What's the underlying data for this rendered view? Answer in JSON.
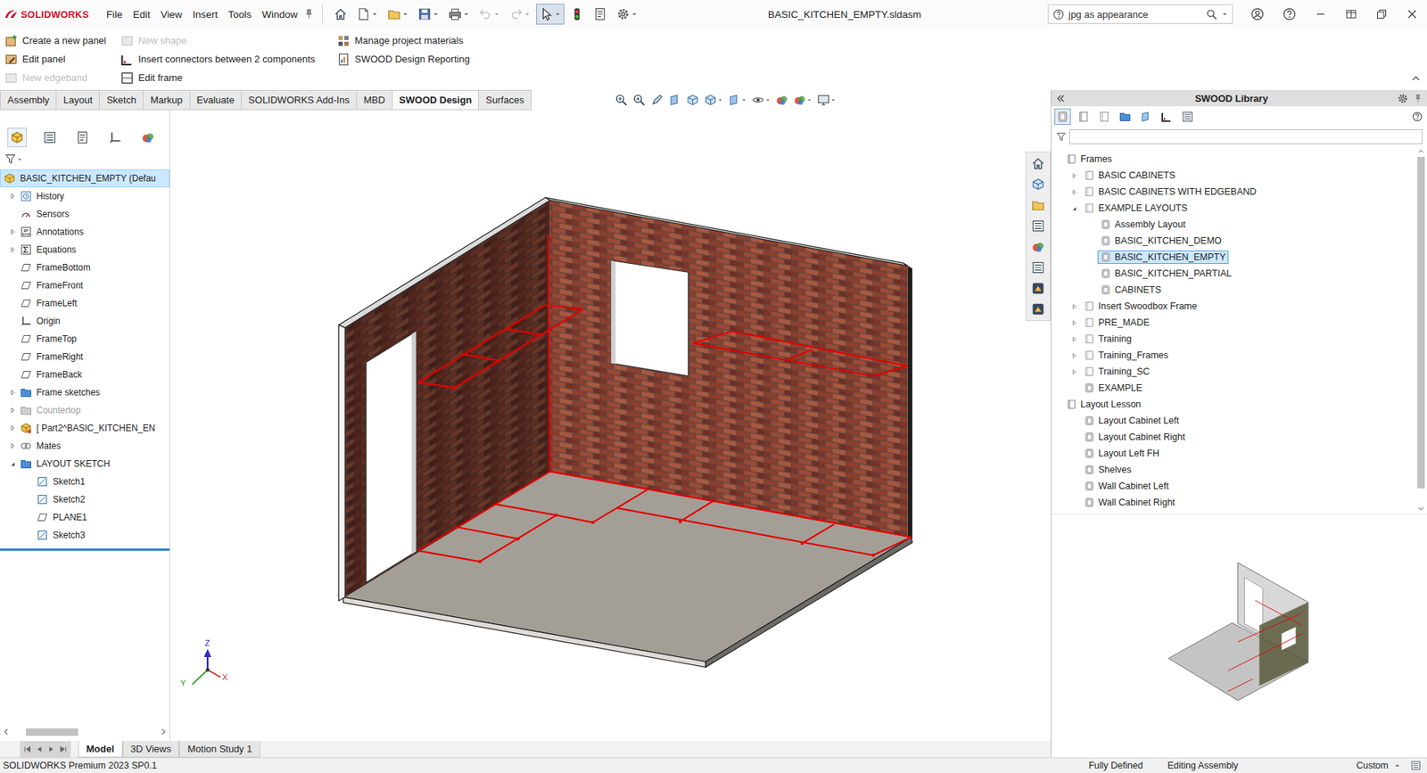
{
  "window": {
    "logo": "SOLIDWORKS",
    "title": "BASIC_KITCHEN_EMPTY.sldasm"
  },
  "menu": [
    "File",
    "Edit",
    "View",
    "Insert",
    "Tools",
    "Window"
  ],
  "quick_access": [
    {
      "disabled": false,
      "selected": false
    },
    {
      "disabled": false,
      "selected": false
    },
    {
      "disabled": false,
      "selected": false
    },
    {
      "disabled": false,
      "selected": false
    },
    {
      "disabled": false,
      "selected": false
    },
    {
      "disabled": true,
      "selected": false
    },
    {
      "disabled": true,
      "selected": false
    },
    {
      "disabled": false,
      "selected": true
    },
    {
      "disabled": false,
      "selected": false
    },
    {
      "disabled": false,
      "selected": false
    },
    {
      "disabled": false,
      "selected": false
    }
  ],
  "search": {
    "value": "jpg as appearance"
  },
  "commands": [
    {
      "label": "Create a new panel",
      "disabled": false
    },
    {
      "label": "Edit panel",
      "disabled": false
    },
    {
      "label": "New edgeband",
      "disabled": true
    },
    {
      "label": "New shape",
      "disabled": true
    },
    {
      "label": "Insert connectors between 2 components",
      "disabled": false
    },
    {
      "label": "Edit frame",
      "disabled": false
    },
    {
      "label": "Manage project materials",
      "disabled": false
    },
    {
      "label": "SWOOD Design Reporting",
      "disabled": false
    }
  ],
  "tabs": [
    {
      "label": "Assembly",
      "selected": false
    },
    {
      "label": "Layout",
      "selected": false
    },
    {
      "label": "Sketch",
      "selected": false
    },
    {
      "label": "Markup",
      "selected": false
    },
    {
      "label": "Evaluate",
      "selected": false
    },
    {
      "label": "SOLIDWORKS Add-Ins",
      "selected": false
    },
    {
      "label": "MBD",
      "selected": false
    },
    {
      "label": "SWOOD Design",
      "selected": true
    },
    {
      "label": "Surfaces",
      "selected": false
    }
  ],
  "feature_tree": {
    "panel_tabs": [
      {
        "selected": true
      },
      {
        "selected": false
      },
      {
        "selected": false
      },
      {
        "selected": false
      },
      {
        "selected": false
      }
    ],
    "items": [
      {
        "label": "BASIC_KITCHEN_EMPTY (Defau",
        "level": 0,
        "kind": "assembly",
        "expandable": false,
        "expanded": false,
        "selected": true,
        "disabled": false
      },
      {
        "label": "History",
        "level": 1,
        "kind": "history",
        "expandable": true,
        "expanded": false,
        "selected": false,
        "disabled": false
      },
      {
        "label": "Sensors",
        "level": 1,
        "kind": "sensor",
        "expandable": false,
        "expanded": false,
        "selected": false,
        "disabled": false
      },
      {
        "label": "Annotations",
        "level": 1,
        "kind": "annotation",
        "expandable": true,
        "expanded": false,
        "selected": false,
        "disabled": false
      },
      {
        "label": "Equations",
        "level": 1,
        "kind": "equation",
        "expandable": true,
        "expanded": false,
        "selected": false,
        "disabled": false
      },
      {
        "label": "FrameBottom",
        "level": 1,
        "kind": "plane",
        "expandable": false,
        "expanded": false,
        "selected": false,
        "disabled": false
      },
      {
        "label": "FrameFront",
        "level": 1,
        "kind": "plane",
        "expandable": false,
        "expanded": false,
        "selected": false,
        "disabled": false
      },
      {
        "label": "FrameLeft",
        "level": 1,
        "kind": "plane",
        "expandable": false,
        "expanded": false,
        "selected": false,
        "disabled": false
      },
      {
        "label": "Origin",
        "level": 1,
        "kind": "origin",
        "expandable": false,
        "expanded": false,
        "selected": false,
        "disabled": false
      },
      {
        "label": "FrameTop",
        "level": 1,
        "kind": "plane",
        "expandable": false,
        "expanded": false,
        "selected": false,
        "disabled": false
      },
      {
        "label": "FrameRight",
        "level": 1,
        "kind": "plane",
        "expandable": false,
        "expanded": false,
        "selected": false,
        "disabled": false
      },
      {
        "label": "FrameBack",
        "level": 1,
        "kind": "plane",
        "expandable": false,
        "expanded": false,
        "selected": false,
        "disabled": false
      },
      {
        "label": "Frame sketches",
        "level": 1,
        "kind": "folder",
        "expandable": true,
        "expanded": false,
        "selected": false,
        "disabled": false
      },
      {
        "label": "Countertop",
        "level": 1,
        "kind": "folder",
        "expandable": true,
        "expanded": false,
        "selected": false,
        "disabled": true
      },
      {
        "label": "[ Part2^BASIC_KITCHEN_EN",
        "level": 1,
        "kind": "part",
        "expandable": true,
        "expanded": false,
        "selected": false,
        "disabled": false
      },
      {
        "label": "Mates",
        "level": 1,
        "kind": "mates",
        "expandable": true,
        "expanded": false,
        "selected": false,
        "disabled": false
      },
      {
        "label": "LAYOUT SKETCH",
        "level": 1,
        "kind": "folder",
        "expandable": true,
        "expanded": true,
        "selected": false,
        "disabled": false
      },
      {
        "label": "Sketch1",
        "level": 2,
        "kind": "sketch",
        "expandable": false,
        "expanded": false,
        "selected": false,
        "disabled": false
      },
      {
        "label": "Sketch2",
        "level": 2,
        "kind": "sketch",
        "expandable": false,
        "expanded": false,
        "selected": false,
        "disabled": false
      },
      {
        "label": "PLANE1",
        "level": 2,
        "kind": "plane",
        "expandable": false,
        "expanded": false,
        "selected": false,
        "disabled": false
      },
      {
        "label": "Sketch3",
        "level": 2,
        "kind": "sketch",
        "expandable": false,
        "expanded": false,
        "selected": false,
        "disabled": false
      }
    ]
  },
  "graphics": {
    "triad": {
      "x": "X",
      "y": "Y",
      "z": "Z"
    }
  },
  "task_pane": {
    "title": "SWOOD Library",
    "toolbar": [
      {
        "selected": true
      },
      {
        "selected": false
      },
      {
        "selected": false
      },
      {
        "selected": false
      },
      {
        "selected": false
      },
      {
        "selected": false
      },
      {
        "selected": false
      }
    ],
    "items": [
      {
        "label": "Frames",
        "level": 0,
        "kind": "library",
        "expandable": false,
        "expanded": false,
        "selected": false
      },
      {
        "label": "BASIC CABINETS",
        "level": 1,
        "kind": "folder",
        "expandable": true,
        "expanded": false,
        "selected": false
      },
      {
        "label": "BASIC CABINETS WITH EDGEBAND",
        "level": 1,
        "kind": "folder",
        "expandable": true,
        "expanded": false,
        "selected": false
      },
      {
        "label": "EXAMPLE LAYOUTS",
        "level": 1,
        "kind": "folder",
        "expandable": true,
        "expanded": true,
        "selected": false
      },
      {
        "label": "Assembly Layout",
        "level": 2,
        "kind": "item",
        "expandable": false,
        "expanded": false,
        "selected": false
      },
      {
        "label": "BASIC_KITCHEN_DEMO",
        "level": 2,
        "kind": "item",
        "expandable": false,
        "expanded": false,
        "selected": false
      },
      {
        "label": "BASIC_KITCHEN_EMPTY",
        "level": 2,
        "kind": "item",
        "expandable": false,
        "expanded": false,
        "selected": true
      },
      {
        "label": "BASIC_KITCHEN_PARTIAL",
        "level": 2,
        "kind": "item",
        "expandable": false,
        "expanded": false,
        "selected": false
      },
      {
        "label": "CABINETS",
        "level": 2,
        "kind": "item",
        "expandable": false,
        "expanded": false,
        "selected": false
      },
      {
        "label": "Insert Swoodbox Frame",
        "level": 1,
        "kind": "folder",
        "expandable": true,
        "expanded": false,
        "selected": false
      },
      {
        "label": "PRE_MADE",
        "level": 1,
        "kind": "folder",
        "expandable": true,
        "expanded": false,
        "selected": false
      },
      {
        "label": "Training",
        "level": 1,
        "kind": "folder",
        "expandable": true,
        "expanded": false,
        "selected": false
      },
      {
        "label": "Training_Frames",
        "level": 1,
        "kind": "folder",
        "expandable": true,
        "expanded": false,
        "selected": false
      },
      {
        "label": "Training_SC",
        "level": 1,
        "kind": "folder",
        "expandable": true,
        "expanded": false,
        "selected": false
      },
      {
        "label": "EXAMPLE",
        "level": 1,
        "kind": "item",
        "expandable": false,
        "expanded": false,
        "selected": false
      },
      {
        "label": "Layout Lesson",
        "level": 0,
        "kind": "library",
        "expandable": false,
        "expanded": false,
        "selected": false
      },
      {
        "label": "Layout Cabinet Left",
        "level": 1,
        "kind": "item",
        "expandable": false,
        "expanded": false,
        "selected": false
      },
      {
        "label": "Layout Cabinet Right",
        "level": 1,
        "kind": "item",
        "expandable": false,
        "expanded": false,
        "selected": false
      },
      {
        "label": "Layout Left FH",
        "level": 1,
        "kind": "item",
        "expandable": false,
        "expanded": false,
        "selected": false
      },
      {
        "label": "Shelves",
        "level": 1,
        "kind": "item",
        "expandable": false,
        "expanded": false,
        "selected": false
      },
      {
        "label": "Wall Cabinet Left",
        "level": 1,
        "kind": "item",
        "expandable": false,
        "expanded": false,
        "selected": false
      },
      {
        "label": "Wall Cabinet Right",
        "level": 1,
        "kind": "item",
        "expandable": false,
        "expanded": false,
        "selected": false
      }
    ]
  },
  "bottom_tabs": [
    {
      "label": "Model",
      "selected": true
    },
    {
      "label": "3D Views",
      "selected": false
    },
    {
      "label": "Motion Study 1",
      "selected": false
    }
  ],
  "status_bar": {
    "product": "SOLIDWORKS Premium 2023 SP0.1",
    "state": "Fully Defined",
    "mode": "Editing Assembly",
    "units": "Custom"
  }
}
